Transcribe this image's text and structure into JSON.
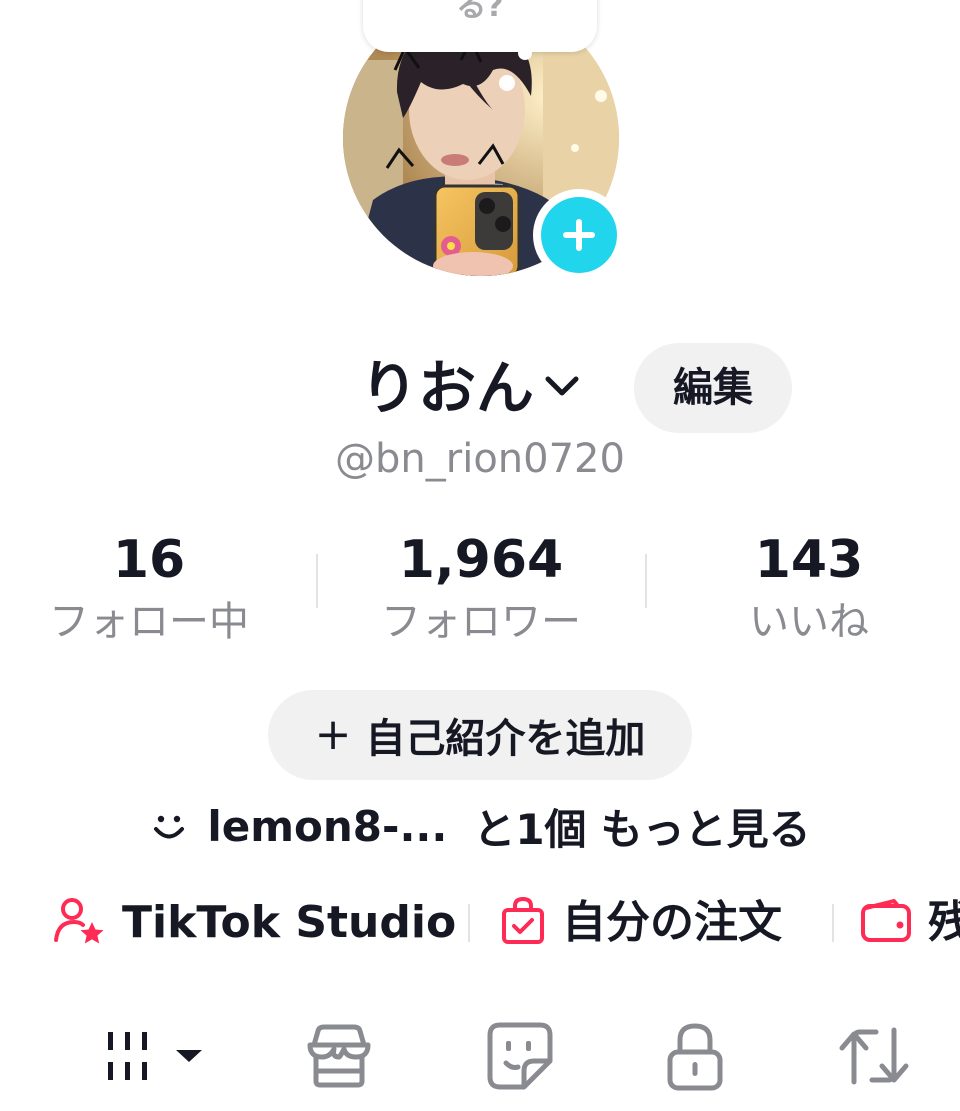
{
  "bubble": {
    "text": "る?"
  },
  "profile": {
    "display_name": "りおん",
    "edit_label": "編集",
    "username": "@bn_rion0720"
  },
  "stats": {
    "following": {
      "value": "16",
      "label": "フォロー中"
    },
    "followers": {
      "value": "1,964",
      "label": "フォロワー"
    },
    "likes": {
      "value": "143",
      "label": "いいね"
    }
  },
  "bio": {
    "add_label": "自己紹介を追加",
    "plus": "+"
  },
  "links": {
    "first": "lemon8-...",
    "count": "と1個",
    "more": "もっと見る"
  },
  "quick_actions": [
    {
      "label": "TikTok Studio",
      "icon": "person-star-icon"
    },
    {
      "label": "自分の注文",
      "icon": "shopping-bag-icon"
    },
    {
      "label": "残",
      "icon": "wallet-icon"
    }
  ],
  "tabs": [
    {
      "icon": "grid-icon"
    },
    {
      "icon": "shop-icon"
    },
    {
      "icon": "sticker-icon"
    },
    {
      "icon": "lock-icon"
    },
    {
      "icon": "repost-icon"
    }
  ],
  "colors": {
    "accent_pink": "#fe2c55",
    "accent_cyan": "#20d5ec",
    "text_primary": "#161823",
    "text_secondary": "#8a8b91",
    "button_bg": "#f1f1f2"
  }
}
